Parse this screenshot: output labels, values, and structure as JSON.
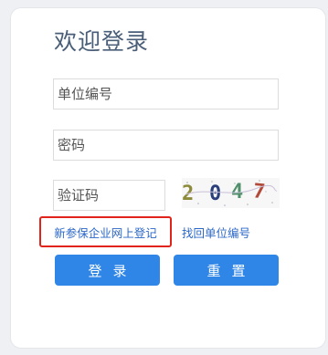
{
  "login": {
    "title": "欢迎登录",
    "unit_code_placeholder": "单位编号",
    "password_placeholder": "密码",
    "captcha_placeholder": "验证码",
    "captcha_text": "2047",
    "register_link": "新参保企业网上登记",
    "recover_link": "找回单位编号",
    "login_button": "登录",
    "reset_button": "重置"
  }
}
